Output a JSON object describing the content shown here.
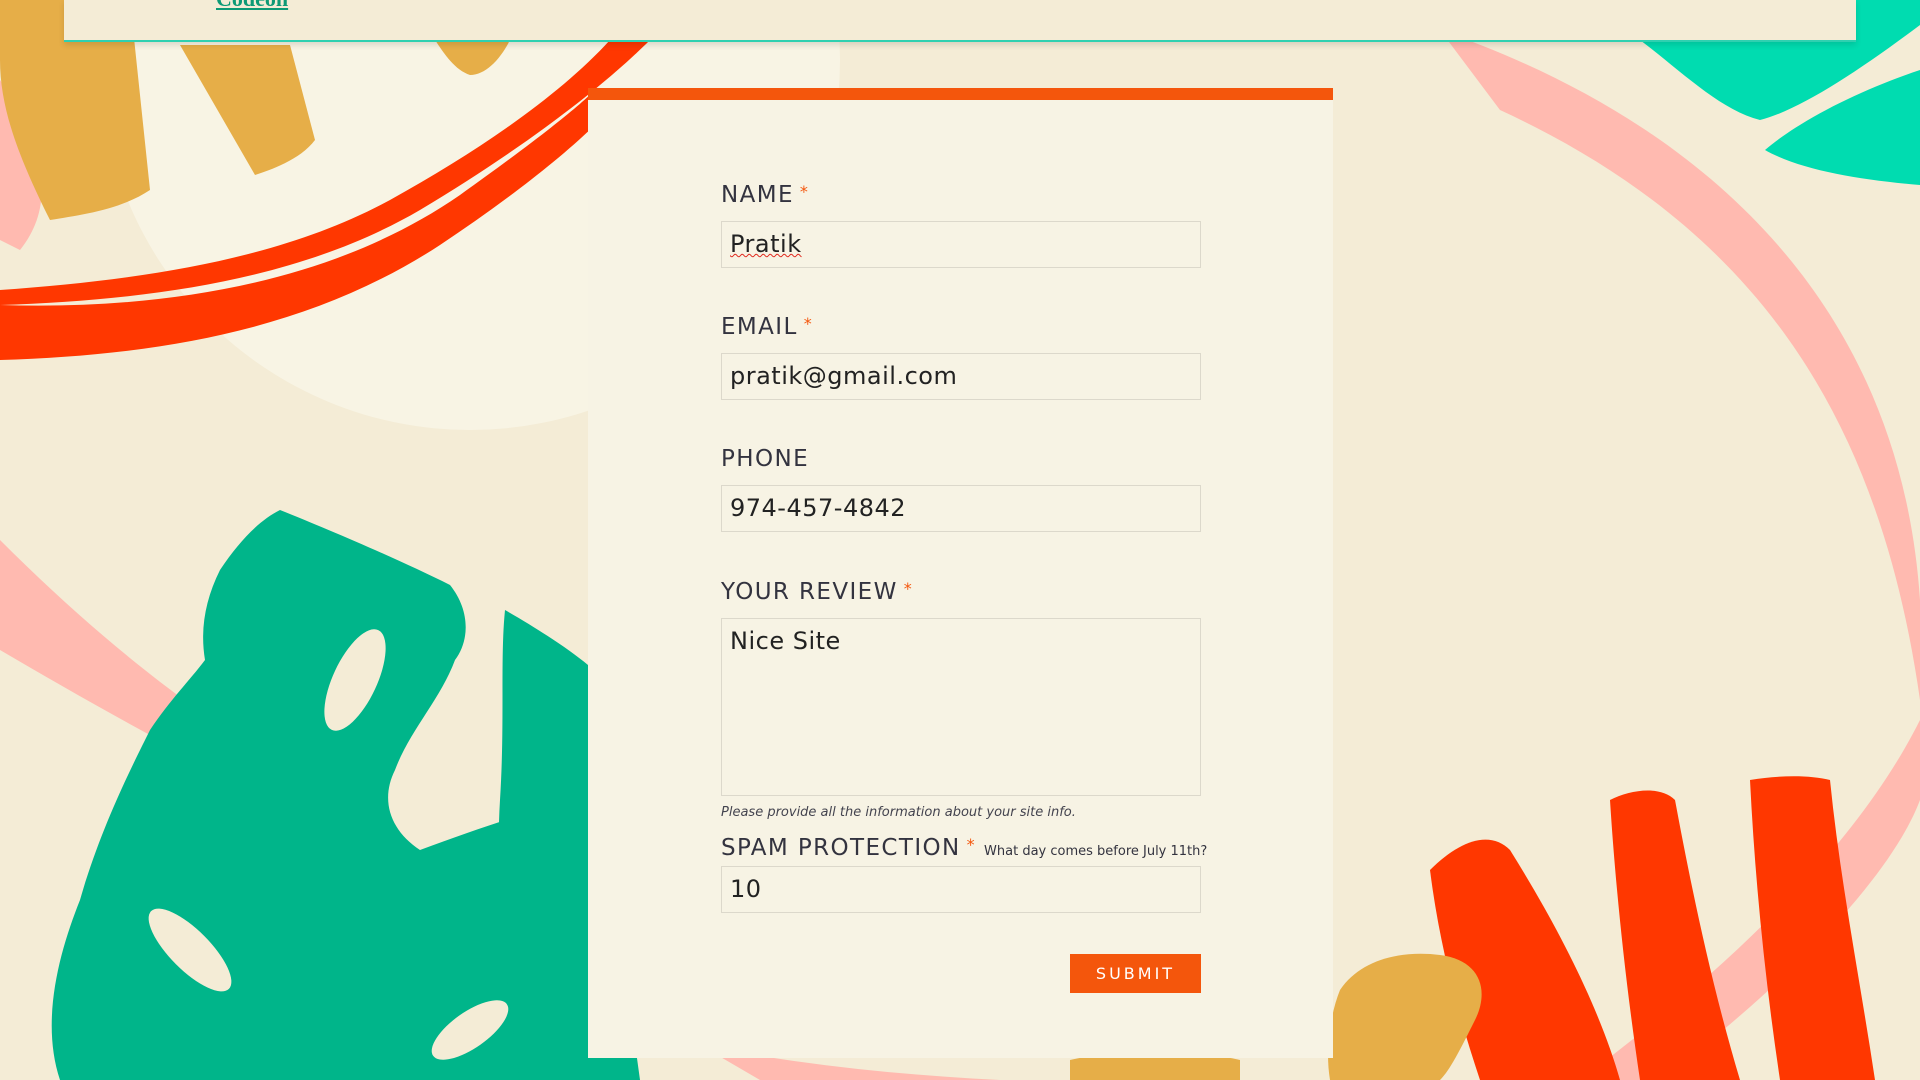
{
  "colors": {
    "accent": "#f4560c",
    "background": "#f4ecd6",
    "card": "#f7f3e4",
    "leaf_green": "#00b58a",
    "teal": "#00dcb0",
    "red": "#ff3700",
    "pink": "#ffbab0",
    "mustard": "#e6ae48",
    "link": "#0c9a76"
  },
  "top_banner": {
    "link_text": "Codeon"
  },
  "form": {
    "required_mark": "*",
    "name": {
      "label": "NAME",
      "value": "Pratik"
    },
    "email": {
      "label": "EMAIL",
      "value": "pratik@gmail.com"
    },
    "phone": {
      "label": "PHONE",
      "value": "974-457-4842"
    },
    "review": {
      "label": "YOUR REVIEW",
      "value": "Nice Site",
      "help": "Please provide all the information about your site info."
    },
    "spam": {
      "label": "SPAM PROTECTION",
      "question": "What day comes before July 11th?",
      "value": "10"
    },
    "submit_label": "SUBMIT"
  }
}
